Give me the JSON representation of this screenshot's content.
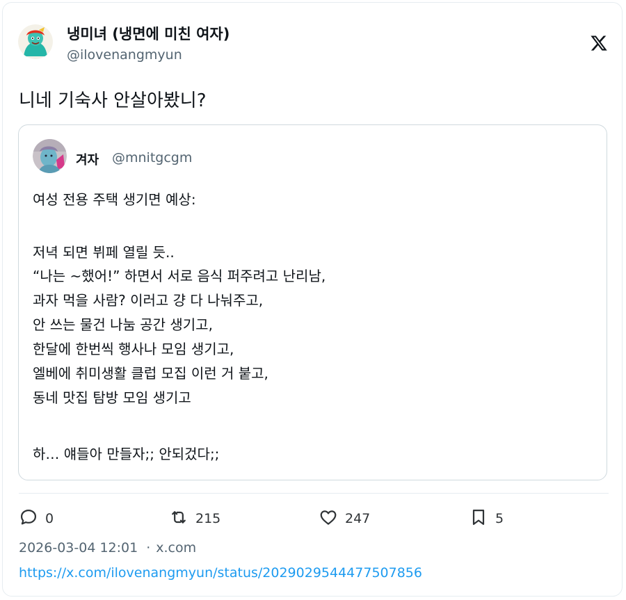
{
  "author": {
    "display_name": "냉미녀 (냉면에 미친 여자)",
    "handle": "@ilovenangmyun",
    "avatar_icon": "cartoon-avatar"
  },
  "brand": {
    "logo_icon": "x-logo-icon"
  },
  "tweet": {
    "text": "니네 기숙사 안살아봤니?"
  },
  "quoted_tweet": {
    "display_name": "겨자",
    "handle": "@mnitgcgm",
    "avatar_icon": "photo-avatar",
    "lines": [
      "여성 전용 주택 생기면 예상:",
      "",
      "저녁 되면 뷔페 열릴 듯..",
      "“나는 ~했어!” 하면서 서로 음식 퍼주려고 난리남,",
      "과자 먹을 사람? 이러고 걍 다 나눠주고,",
      "안 쓰는 물건 나눔 공간 생기고,",
      "한달에 한번씩 행사나 모임 생기고,",
      "엘베에 취미생활 클럽 모집 이런 거 붙고,",
      "동네 맛집 탐방 모임 생기고",
      "",
      "하… 얘들아 만들자;; 안되겄다;;"
    ]
  },
  "actions": {
    "replies": {
      "icon": "reply-icon",
      "count": "0"
    },
    "reposts": {
      "icon": "repost-icon",
      "count": "215"
    },
    "likes": {
      "icon": "heart-icon",
      "count": "247"
    },
    "bookmarks": {
      "icon": "bookmark-icon",
      "count": "5"
    }
  },
  "meta": {
    "timestamp": "2026-03-04 12:01",
    "separator": "·",
    "source": "x.com",
    "url": "https://x.com/ilovenangmyun/status/2029029544477507856"
  },
  "colors": {
    "text": "#0f1419",
    "secondary": "#536471",
    "link": "#1d9bf0",
    "border": "#cfd9de"
  }
}
